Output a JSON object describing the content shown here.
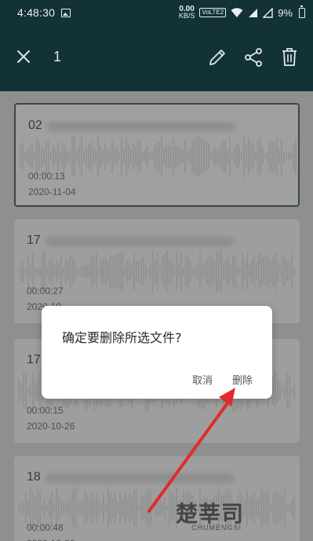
{
  "status_bar": {
    "time": "4:48:30",
    "net_speed_value": "0.00",
    "net_speed_unit": "KB/S",
    "network_badge": "VoLTE2",
    "battery": "9%"
  },
  "app_bar": {
    "selected_count": "1",
    "icons": [
      "close-icon",
      "edit-icon",
      "share-icon",
      "trash-icon"
    ]
  },
  "recordings": [
    {
      "name": "02",
      "duration": "00:00:13",
      "date": "2020-11-04",
      "selected": true
    },
    {
      "name": "17",
      "duration": "00:00:27",
      "date": "2020-10-",
      "selected": false
    },
    {
      "name": "17",
      "duration": "00:00:15",
      "date": "2020-10-26",
      "selected": false
    },
    {
      "name": "18",
      "duration": "00:00:48",
      "date": "2020-10-26",
      "selected": false
    }
  ],
  "dialog": {
    "message": "确定要删除所选文件?",
    "cancel_label": "取消",
    "delete_label": "删除"
  },
  "annotation": {
    "arrow_color": "#e02b2b"
  },
  "watermark": {
    "mark": "楚莘司",
    "sub": "CHUMENGSI"
  },
  "colors": {
    "app_bar": "#123238",
    "dialog_bg": "#ffffff",
    "scrim_list": "#8f8f8f"
  }
}
